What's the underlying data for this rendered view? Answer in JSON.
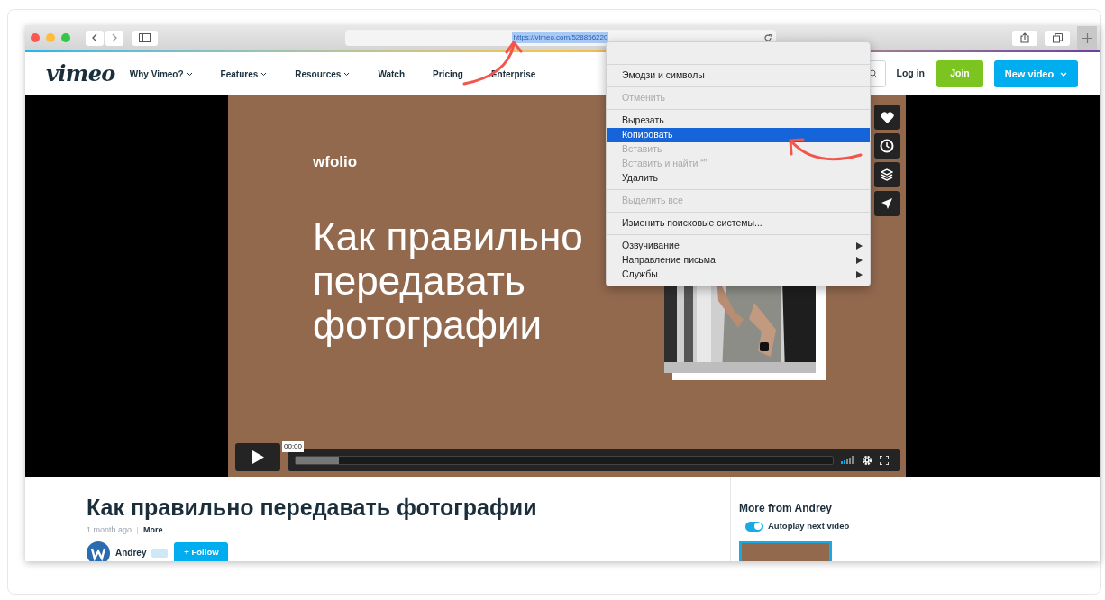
{
  "browser": {
    "url": "https://vimeo.com/528856220",
    "url_selected": true
  },
  "site_nav": {
    "logo": "vimeo",
    "items": [
      {
        "label": "Why Vimeo?",
        "dropdown": true
      },
      {
        "label": "Features",
        "dropdown": true
      },
      {
        "label": "Resources",
        "dropdown": true
      },
      {
        "label": "Watch",
        "dropdown": false
      },
      {
        "label": "Pricing",
        "dropdown": false
      },
      {
        "label": "Enterprise",
        "dropdown": false
      }
    ],
    "login": "Log in",
    "join": "Join",
    "new_video": "New video"
  },
  "video": {
    "brand": "wfolio",
    "slide_title": [
      "Как правильно",
      "передавать",
      "фотографии"
    ],
    "time": "00:00",
    "progress": {
      "level": 0.08
    },
    "volume": {
      "level": 0.4
    }
  },
  "context_menu": {
    "groups": [
      [
        {
          "label": "Эмодзи и символы",
          "disabled": false,
          "selected": false,
          "submenu": false
        }
      ],
      [
        {
          "label": "Отменить",
          "disabled": true,
          "selected": false,
          "submenu": false
        }
      ],
      [
        {
          "label": "Вырезать",
          "disabled": false,
          "selected": false,
          "submenu": false
        },
        {
          "label": "Копировать",
          "disabled": false,
          "selected": true,
          "submenu": false
        },
        {
          "label": "Вставить",
          "disabled": true,
          "selected": false,
          "submenu": false
        },
        {
          "label": "Вставить и найти “”",
          "disabled": true,
          "selected": false,
          "submenu": false
        },
        {
          "label": "Удалить",
          "disabled": false,
          "selected": false,
          "submenu": false
        }
      ],
      [
        {
          "label": "Выделить все",
          "disabled": true,
          "selected": false,
          "submenu": false
        }
      ],
      [
        {
          "label": "Изменить поисковые системы...",
          "disabled": false,
          "selected": false,
          "submenu": false
        }
      ],
      [
        {
          "label": "Озвучивание",
          "disabled": false,
          "selected": false,
          "submenu": true
        },
        {
          "label": "Направление письма",
          "disabled": false,
          "selected": false,
          "submenu": true
        },
        {
          "label": "Службы",
          "disabled": false,
          "selected": false,
          "submenu": true
        }
      ]
    ]
  },
  "details": {
    "title": "Как правильно передавать фотографии",
    "age": "1 month ago",
    "more": "More",
    "author": "Andrey",
    "follow": "+ Follow"
  },
  "sidebar": {
    "heading": "More from Andrey",
    "autoplay": {
      "label": "Autoplay next video",
      "on": true
    }
  }
}
